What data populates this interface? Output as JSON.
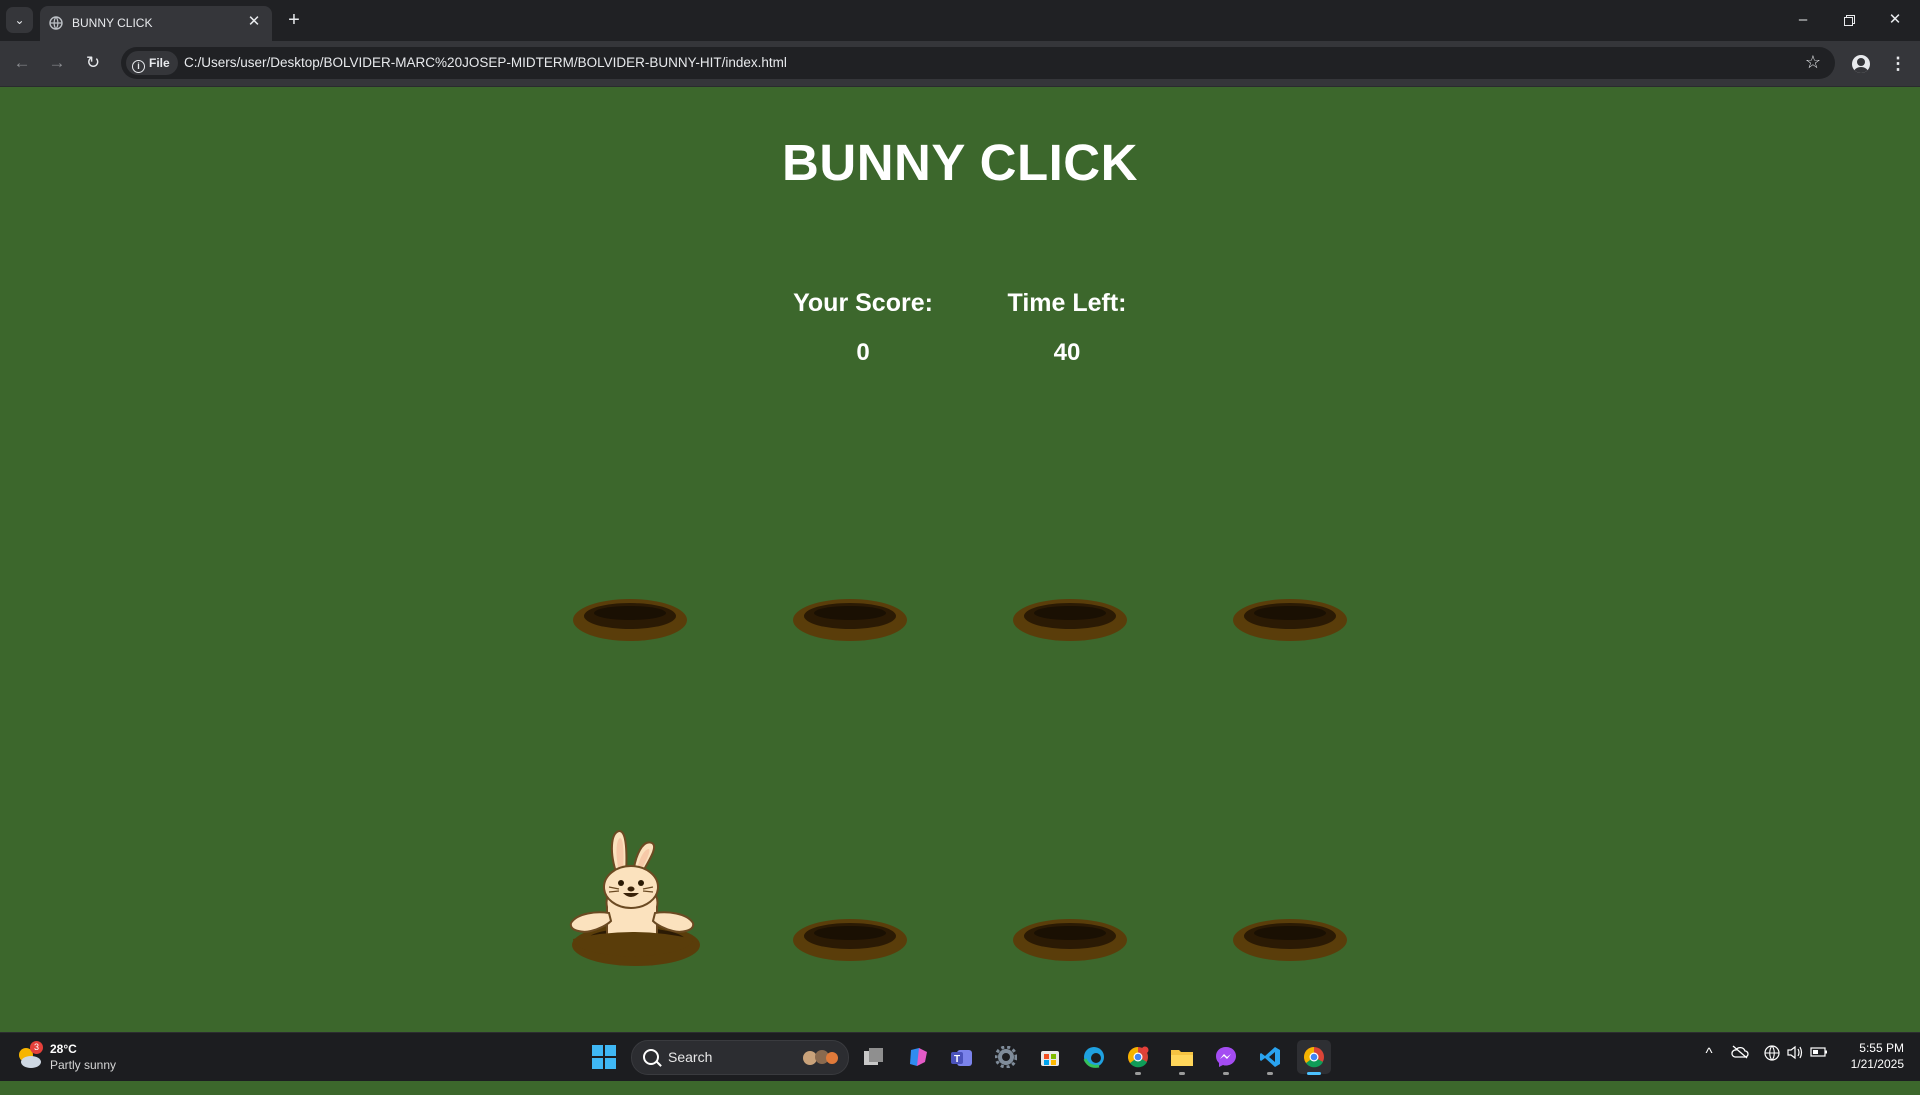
{
  "browser": {
    "tab_title": "BUNNY CLICK",
    "site_chip": "File",
    "url": "C:/Users/user/Desktop/BOLVIDER-MARC%20JOSEP-MIDTERM/BOLVIDER-BUNNY-HIT/index.html"
  },
  "game": {
    "title": "BUNNY CLICK",
    "score_label": "Your Score:",
    "score_value": "0",
    "time_label": "Time Left:",
    "time_value": "40",
    "restart_icon": "↻",
    "holes": [
      {
        "row": 1,
        "col": 1,
        "bunny": false
      },
      {
        "row": 1,
        "col": 2,
        "bunny": false
      },
      {
        "row": 1,
        "col": 3,
        "bunny": false
      },
      {
        "row": 1,
        "col": 4,
        "bunny": false
      },
      {
        "row": 2,
        "col": 1,
        "bunny": true
      },
      {
        "row": 2,
        "col": 2,
        "bunny": false
      },
      {
        "row": 2,
        "col": 3,
        "bunny": false
      },
      {
        "row": 2,
        "col": 4,
        "bunny": false
      }
    ]
  },
  "taskbar": {
    "weather_badge": "3",
    "temperature": "28°C",
    "condition": "Partly sunny",
    "search_label": "Search",
    "time": "5:55 PM",
    "date": "1/21/2025"
  },
  "colors": {
    "page_background": "#3c672c",
    "hole": "#5a3d0a",
    "hole_inner": "#2b1a04",
    "bunny_body": "#fbe2be"
  }
}
